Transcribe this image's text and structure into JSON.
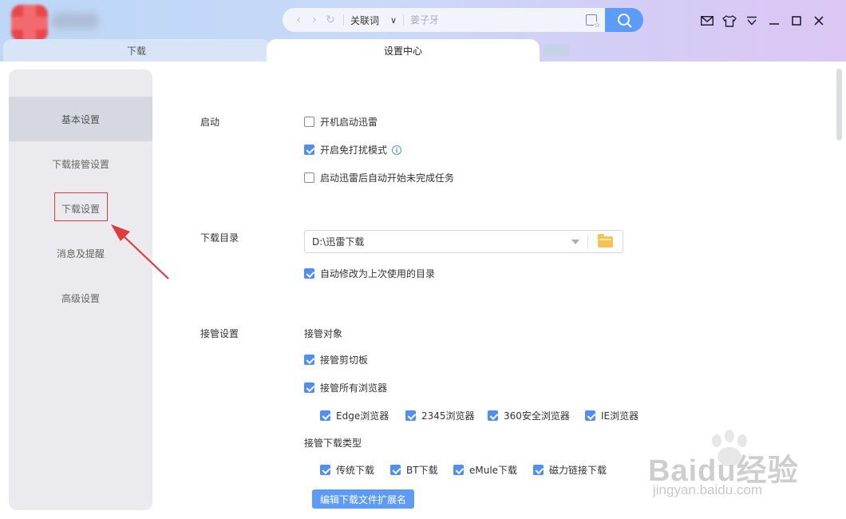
{
  "titlebar": {
    "nav": {
      "back_icon": "chevron-left-icon",
      "forward_icon": "chevron-right-icon",
      "refresh_icon": "refresh-icon"
    },
    "search_mode": "关联词",
    "search_placeholder": "姜子牙",
    "window_controls": [
      "mail-icon",
      "skin-icon",
      "menu-icon",
      "minimize-icon",
      "maximize-icon",
      "close-icon"
    ]
  },
  "tabs": {
    "download": "下载",
    "settings": "设置中心"
  },
  "sidebar": {
    "items": [
      {
        "label": "基本设置",
        "active": true
      },
      {
        "label": "下载接管设置",
        "active": false
      },
      {
        "label": "下载设置",
        "active": false
      },
      {
        "label": "消息及提醒",
        "active": false
      },
      {
        "label": "高级设置",
        "active": false
      }
    ]
  },
  "startup": {
    "label": "启动",
    "options": [
      {
        "label": "开机启动迅雷",
        "checked": false
      },
      {
        "label": "开启免打扰模式",
        "checked": true
      },
      {
        "label": "启动迅雷后自动开始未完成任务",
        "checked": false
      }
    ]
  },
  "download_dir": {
    "label": "下载目录",
    "value": "D:\\迅雷下载",
    "auto_modify": {
      "label": "自动修改为上次使用的目录",
      "checked": true
    }
  },
  "takeover": {
    "label": "接管设置",
    "objects_title": "接管对象",
    "clipboard": {
      "label": "接管剪切板",
      "checked": true
    },
    "all_browsers": {
      "label": "接管所有浏览器",
      "checked": true
    },
    "browsers": [
      {
        "label": "Edge浏览器",
        "checked": true
      },
      {
        "label": "2345浏览器",
        "checked": true
      },
      {
        "label": "360安全浏览器",
        "checked": true
      },
      {
        "label": "IE浏览器",
        "checked": true
      }
    ],
    "types_title": "接管下载类型",
    "types": [
      {
        "label": "传统下载",
        "checked": true
      },
      {
        "label": "BT下载",
        "checked": true
      },
      {
        "label": "eMule下载",
        "checked": true
      },
      {
        "label": "磁力链接下载",
        "checked": true
      }
    ],
    "edit_ext_button": "编辑下载文件扩展名"
  },
  "watermark": {
    "text": "Baidu经验",
    "sub": "jingyan.baidu.com"
  },
  "colors": {
    "accent": "#5d9cf6",
    "checkbox_on": "#4f8ff0",
    "annotation_red": "#e23b3b"
  }
}
